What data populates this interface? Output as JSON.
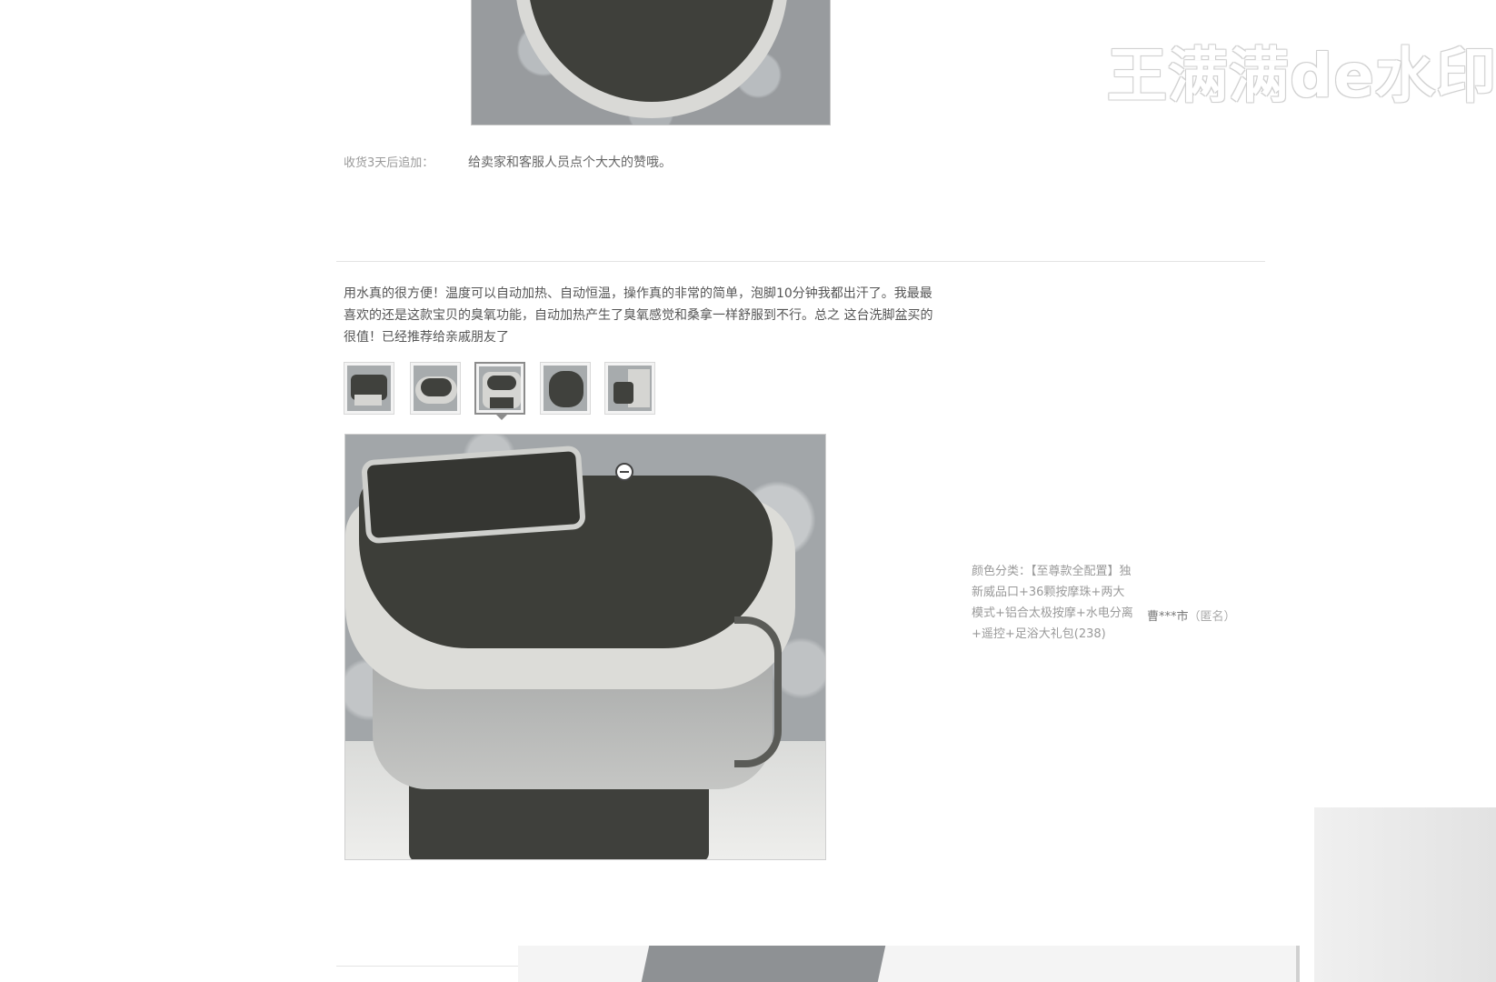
{
  "watermark": "王满满de水印",
  "appended_review": {
    "label": "收货3天后追加：",
    "text": "给卖家和客服人员点个大大的赞哦。"
  },
  "review": {
    "text": "用水真的很方便！温度可以自动加热、自动恒温，操作真的非常的简单，泡脚10分钟我都出汗了。我最最喜欢的还是这款宝贝的臭氧功能，自动加热产生了臭氧感觉和桑拿一样舒服到不行。总之 这台洗脚盆买的很值！已经推荐给亲戚朋友了",
    "thumbnails": [
      {
        "name": "photo-1",
        "selected": false
      },
      {
        "name": "photo-2",
        "selected": false
      },
      {
        "name": "photo-3",
        "selected": true
      },
      {
        "name": "photo-4",
        "selected": false
      },
      {
        "name": "photo-5",
        "selected": false
      }
    ],
    "zoom_icon": "zoom-out-icon"
  },
  "sku": {
    "text": "颜色分类：【至尊款全配置】独新威品口+36颗按摩珠+两大模式+铝合太极按摩+水电分离+遥控+足浴大礼包(238)"
  },
  "user": {
    "name": "曹***市",
    "anon": "（匿名）"
  }
}
